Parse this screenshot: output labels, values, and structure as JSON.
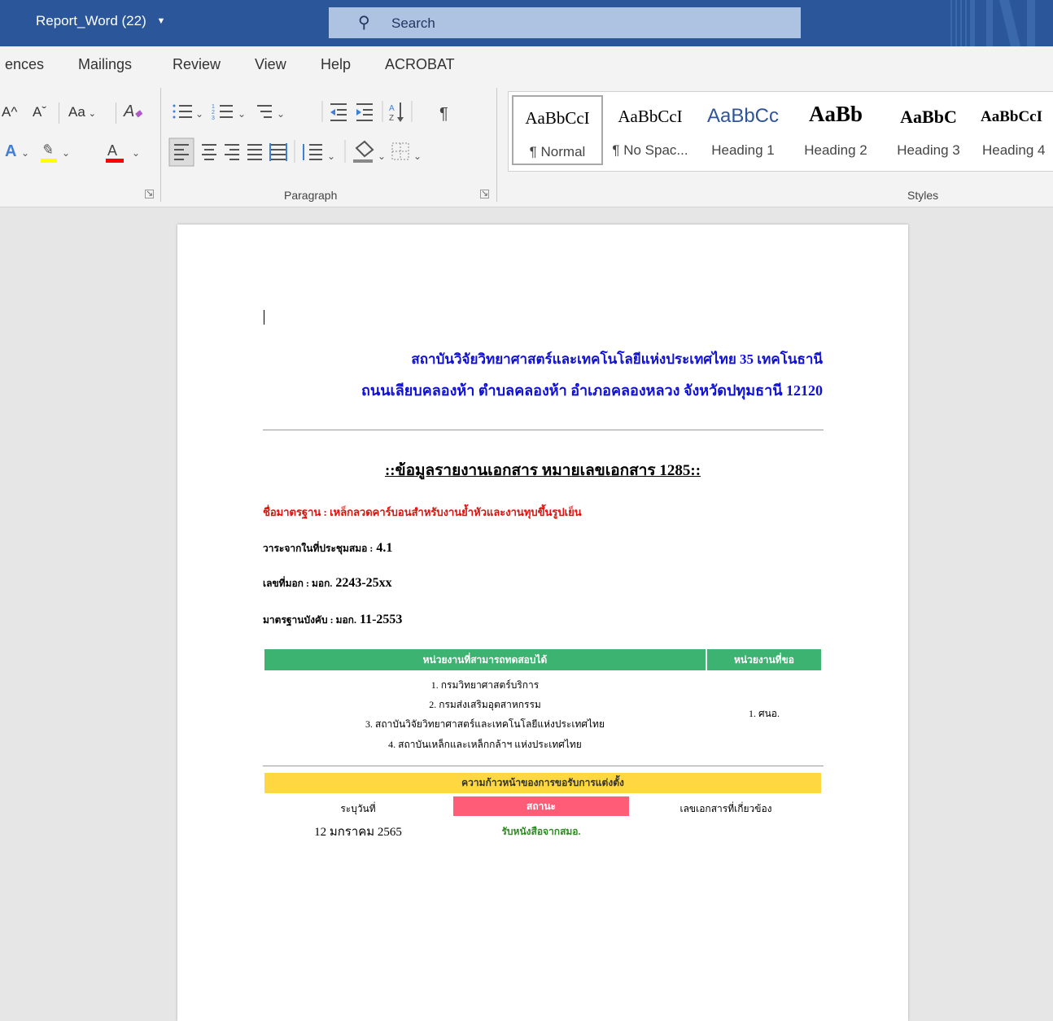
{
  "titlebar": {
    "doc_title": "Report_Word (22)",
    "search_label": "Search",
    "colors": {
      "bar": "#2b579a"
    }
  },
  "ribbon_tabs": [
    "ences",
    "Mailings",
    "Review",
    "View",
    "Help",
    "ACROBAT"
  ],
  "ribbon": {
    "font_group": {
      "grow_font": "A^",
      "shrink_font": "Aˇ",
      "change_case": "Aa",
      "clear_format": "A"
    },
    "paragraph_label": "Paragraph",
    "styles_label": "Styles",
    "styles": [
      {
        "preview": "AaBbCcI",
        "name": "¶ Normal"
      },
      {
        "preview": "AaBbCcI",
        "name": "¶ No Spac..."
      },
      {
        "preview": "AaBbCc",
        "name": "Heading 1"
      },
      {
        "preview": "AaBb",
        "name": "Heading 2"
      },
      {
        "preview": "AaBbC",
        "name": "Heading 3"
      },
      {
        "preview": "AaBbCcI",
        "name": "Heading 4"
      }
    ]
  },
  "document": {
    "address_line1": "สถาบันวิจัยวิทยาศาสตร์และเทคโนโลยีแห่งประเทศไทย 35 เทคโนธานี",
    "address_line2": "ถนนเลียบคลองห้า ตำบลคลองห้า อำเภอคลองหลวง จังหวัดปทุมธานี 12120",
    "heading": "::ข้อมูลรายงานเอกสาร หมายเลขเอกสาร 1285::",
    "standard_name": "ชื่อมาตรฐาน : เหล็กลวดคาร์บอนสำหรับงานย้ำหัวและงานทุบขึ้นรูปเย็น",
    "agenda_label": "วาระจากในที่ประชุมสมอ :",
    "agenda_value": "4.1",
    "tis_no_label": "เลขที่มอก : มอก.",
    "tis_no_value": "2243-25xx",
    "mandatory_label": "มาตรฐานบังคับ : มอก.",
    "mandatory_value": "11-2553",
    "agencies_table": {
      "col_headers": [
        "หน่วยงานที่สามารถทดสอบได้",
        "หน่วยงานที่ขอ"
      ],
      "agencies": [
        "1. กรมวิทยาศาสตร์บริการ",
        "2. กรมส่งเสริมอุตสาหกรรม",
        "3. สถาบันวิจัยวิทยาศาสตร์และเทคโนโลยีแห่งประเทศไทย",
        "4. สถาบันเหล็กและเหล็กกล้าฯ แห่งประเทศไทย"
      ],
      "requester": "1. ศนอ.",
      "colors": {
        "header": "#3cb371"
      }
    },
    "progress_table": {
      "title": "ความก้าวหน้าของการขอรับการแต่งตั้ง",
      "col_headers": [
        "ระบุวันที่",
        "สถานะ",
        "เลขเอกสารที่เกี่ยวข้อง"
      ],
      "row": {
        "date": "12 มกราคม 2565",
        "status": "รับหนังสือจากสมอ.",
        "docs": ""
      },
      "colors": {
        "title": "#ffd740",
        "status_header": "#ff5c78",
        "status_text": "#2e8b22"
      }
    }
  }
}
